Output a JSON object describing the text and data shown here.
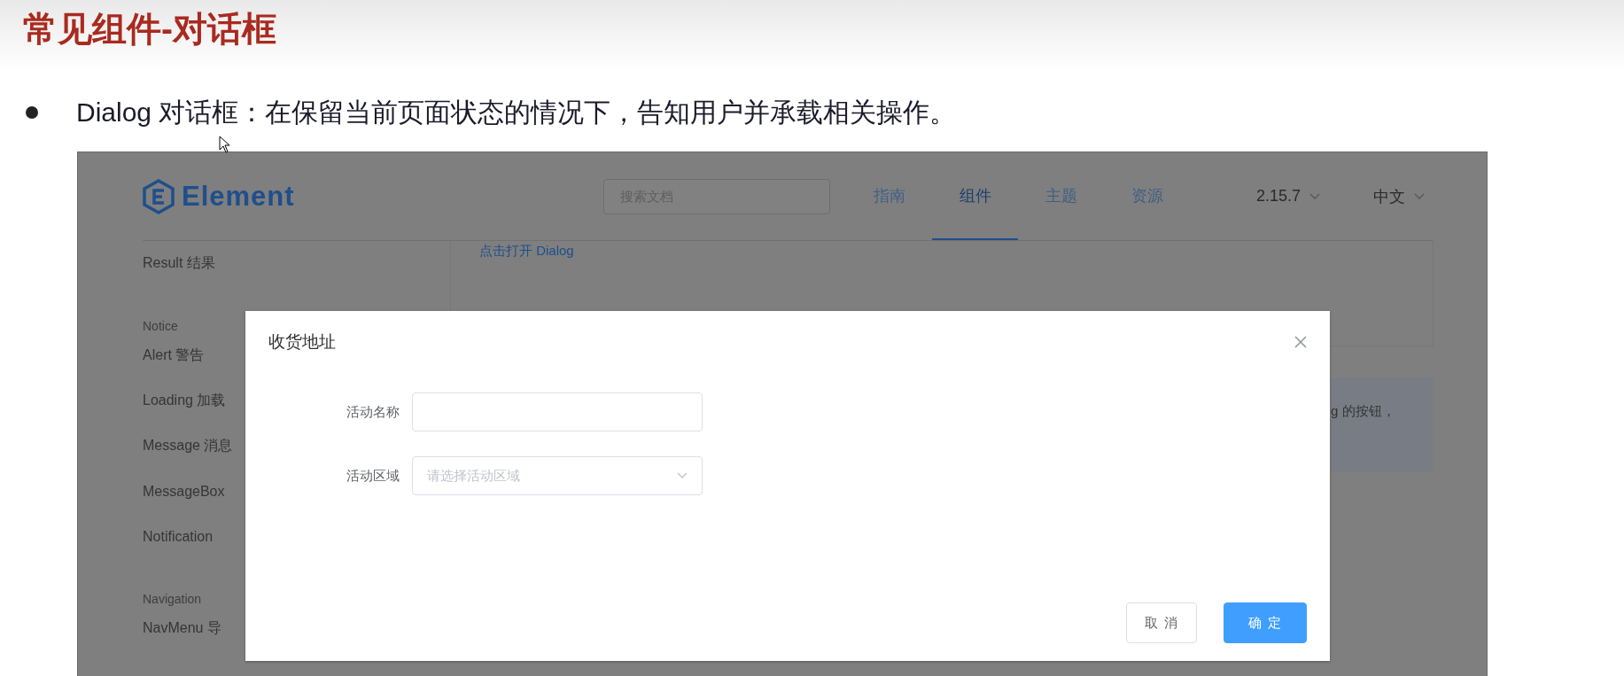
{
  "slide": {
    "title": "常见组件-对话框",
    "bullet": "Dialog 对话框：在保留当前页面状态的情况下，告知用户并承载相关操作。"
  },
  "screenshot": {
    "logo": "Element",
    "search": {
      "placeholder": "搜索文档"
    },
    "nav": [
      {
        "label": "指南",
        "selected": false
      },
      {
        "label": "组件",
        "selected": true
      },
      {
        "label": "主题",
        "selected": false
      },
      {
        "label": "资源",
        "selected": false
      }
    ],
    "version": "2.15.7",
    "language": "中文",
    "sidebar": [
      {
        "kind": "item",
        "label": "Result 结果"
      },
      {
        "kind": "group",
        "label": "Notice"
      },
      {
        "kind": "item",
        "label": "Alert 警告"
      },
      {
        "kind": "item",
        "label": "Loading 加载"
      },
      {
        "kind": "item",
        "label": "Message 消息"
      },
      {
        "kind": "item",
        "label": "MessageBox"
      },
      {
        "kind": "item",
        "label": "Notification"
      },
      {
        "kind": "group",
        "label": "Navigation"
      },
      {
        "kind": "item",
        "label": "NavMenu 导"
      }
    ],
    "content": {
      "link": "点击打开 Dialog",
      "info_text": "g 的按钮，"
    },
    "dialog": {
      "title": "收货地址",
      "fields": [
        {
          "kind": "input",
          "label": "活动名称"
        },
        {
          "kind": "select",
          "label": "活动区域",
          "placeholder": "请选择活动区域"
        }
      ],
      "buttons": [
        {
          "kind": "default",
          "label": "取 消"
        },
        {
          "kind": "primary",
          "label": "确 定"
        }
      ]
    }
  }
}
